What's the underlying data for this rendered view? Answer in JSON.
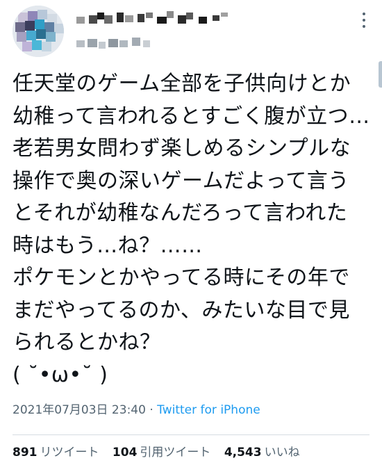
{
  "tweet": {
    "body_lines": [
      "任天堂のゲーム全部を子供向けとか",
      "幼稚って言われるとすごく腹が立つ…",
      "老若男女問わず楽しめるシンプルな",
      "操作で奥の深いゲームだよって言う",
      "とそれが幼稚なんだろって言われた",
      "時はもう…ね？……",
      "ポケモンとかやってる時にその年で",
      "まだやってるのか、みたいな目で見",
      "られるとかね？",
      "( ˘•ω•˘ )"
    ],
    "timestamp": "2021年07月03日 23:40",
    "separator": " · ",
    "source": "Twitter for iPhone"
  },
  "stats": {
    "retweets": {
      "count": "891",
      "label": "リツイート"
    },
    "quotes": {
      "count": "104",
      "label": "引用ツイート"
    },
    "likes": {
      "count": "4,543",
      "label": "いいね"
    }
  },
  "colors": {
    "text": "#0f1419",
    "secondary": "#536471",
    "link": "#1d9bf0",
    "divider": "#d5dce2"
  },
  "icons": {
    "more": "more-vertical-icon"
  }
}
